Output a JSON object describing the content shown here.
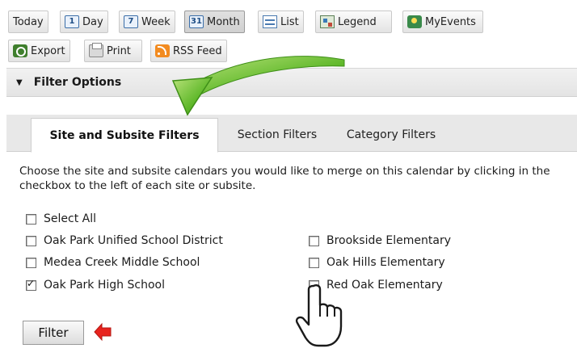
{
  "toolbar": {
    "row1": [
      {
        "key": "today",
        "label": "Today",
        "icon": ""
      },
      {
        "key": "day",
        "label": "Day",
        "icon": "1"
      },
      {
        "key": "week",
        "label": "Week",
        "icon": "7"
      },
      {
        "key": "month",
        "label": "Month",
        "icon": "31",
        "active": true
      },
      {
        "key": "list",
        "label": "List",
        "icon": "list-icon"
      },
      {
        "key": "legend",
        "label": "Legend",
        "icon": "legend-icon"
      },
      {
        "key": "myevents",
        "label": "MyEvents",
        "icon": "myevents-icon"
      }
    ],
    "row2": [
      {
        "key": "export",
        "label": "Export",
        "icon": "export-icon"
      },
      {
        "key": "print",
        "label": "Print",
        "icon": "printer-icon"
      },
      {
        "key": "rss",
        "label": "RSS Feed",
        "icon": "rss-icon"
      }
    ]
  },
  "filter_options": {
    "title": "Filter Options",
    "caret": "▼"
  },
  "tabs": [
    {
      "label": "Site and Subsite Filters",
      "active": true
    },
    {
      "label": "Section Filters"
    },
    {
      "label": "Category Filters"
    }
  ],
  "description": "Choose the site and subsite calendars you would like to merge on this calendar by clicking in the checkbox to the left of each site or subsite.",
  "checkboxes": {
    "select_all": {
      "label": "Select All",
      "checked": false
    },
    "left": [
      {
        "label": "Oak Park Unified School District",
        "checked": false
      },
      {
        "label": "Medea Creek Middle School",
        "checked": false
      },
      {
        "label": "Oak Park High School",
        "checked": true
      }
    ],
    "right": [
      {
        "label": "Brookside Elementary",
        "checked": false
      },
      {
        "label": "Oak Hills Elementary",
        "checked": false
      },
      {
        "label": "Red Oak Elementary",
        "checked": false
      }
    ]
  },
  "filter_button": {
    "label": "Filter"
  },
  "annotations": {
    "arrow_color": "#5fb82a",
    "pointer_arrow_color": "#e8231e",
    "hand_cursor": "hand-cursor-icon"
  }
}
